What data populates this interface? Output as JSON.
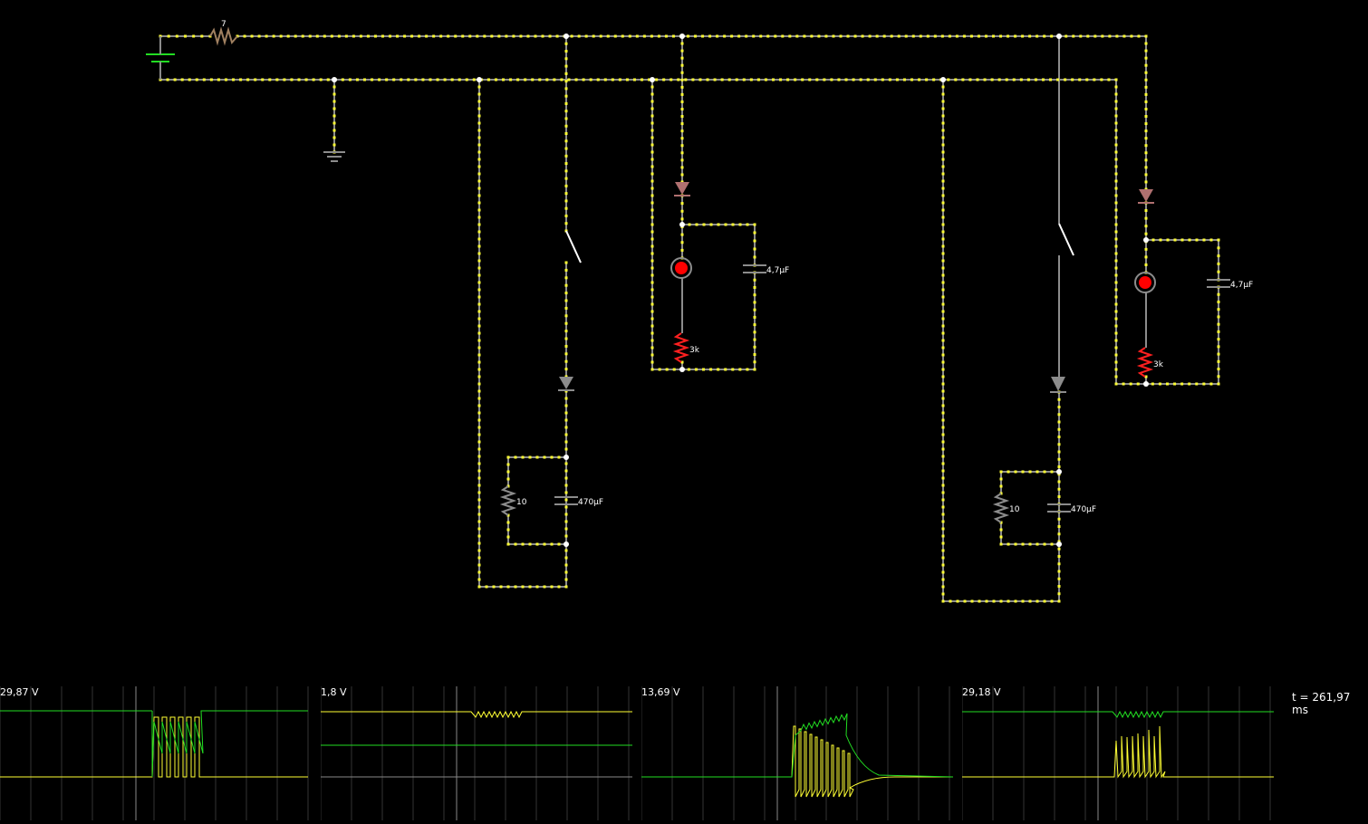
{
  "circuit": {
    "colors": {
      "wire": "#8c8c8c",
      "current": "#ffff33",
      "node": "#ffffff",
      "battery": "#22dd22",
      "resistor_hot": "#ff2020",
      "diode": "#b07070",
      "lamp": "#ff0000",
      "label": "#ffffff"
    },
    "labels": {
      "r_supply": "7",
      "cap_top_left": "4,7µF",
      "r_led_left": "3k",
      "cap_bottom_left": "470µF",
      "r_bottom_left": "10",
      "cap_top_right": "4,7µF",
      "r_led_right": "3k",
      "cap_bottom_right": "470µF",
      "r_bottom_right": "10"
    }
  },
  "scopes": [
    {
      "label": "29,87 V",
      "traces": [
        "green",
        "yellow"
      ]
    },
    {
      "label": "1,8 V",
      "traces": [
        "yellow",
        "green",
        "gray"
      ]
    },
    {
      "label": "13,69 V",
      "traces": [
        "green",
        "yellow"
      ]
    },
    {
      "label": "29,18 V",
      "traces": [
        "green",
        "yellow"
      ]
    }
  ],
  "time": {
    "label": "t = 261,97 ms"
  }
}
